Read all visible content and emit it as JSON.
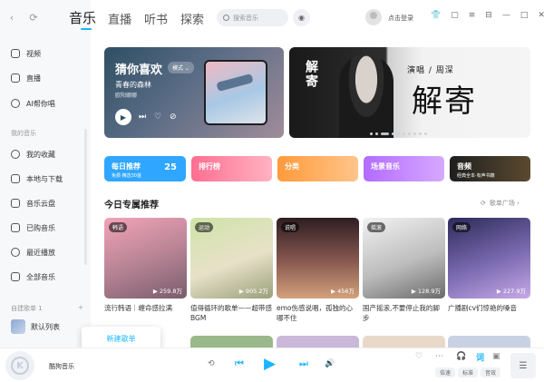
{
  "nav": {
    "back": "‹",
    "refresh": "⟳"
  },
  "sidebar": {
    "items_top": [
      {
        "label": "视频"
      },
      {
        "label": "直播"
      },
      {
        "label": "AI帮你唱"
      }
    ],
    "section_my": "我的音乐",
    "items_my": [
      {
        "label": "我的收藏"
      },
      {
        "label": "本地与下载"
      },
      {
        "label": "音乐云盘"
      },
      {
        "label": "已购音乐"
      },
      {
        "label": "最近播放"
      },
      {
        "label": "全部音乐"
      }
    ],
    "created_playlists": "自建歌单 1",
    "add": "+",
    "playlist": "默认列表"
  },
  "tabs": [
    {
      "label": "音乐"
    },
    {
      "label": "直播"
    },
    {
      "label": "听书"
    },
    {
      "label": "探索"
    }
  ],
  "search": {
    "placeholder": "搜索音乐"
  },
  "user": {
    "login": "点击登录"
  },
  "banner_left": {
    "title": "猜你喜欢",
    "mode": "模式 ⌄",
    "song": "青春的森林",
    "artist": "欧阳娜娜"
  },
  "banner_right": {
    "vertical": "解寄",
    "subtitle": "演唱 / 周深",
    "big": "解寄"
  },
  "categories": [
    {
      "label": "每日推荐",
      "sub": "免费·精选30首",
      "num": "25",
      "color": "#2fa6ff"
    },
    {
      "label": "排行榜",
      "color": "#ff6e91"
    },
    {
      "label": "分类",
      "color": "#ff9a3c"
    },
    {
      "label": "场景音乐",
      "color": "#b36bff"
    },
    {
      "label": "音频",
      "sub": "经典全本·有声书籍",
      "color": "#1e1e1e"
    }
  ],
  "section": {
    "title": "今日专属推荐",
    "more": "歌单广场 ›"
  },
  "cards": [
    {
      "tag": "韩语",
      "plays": "▶ 259.8万",
      "name": "流行韩语｜缠命感拉满",
      "c1": "#f3a3b8",
      "c2": "#7a5d6c"
    },
    {
      "tag": "运动",
      "plays": "▶ 905.2万",
      "name": "值得循环的歌单——超带感BGM",
      "c1": "#cfe3a8",
      "c2": "#e7e1c8"
    },
    {
      "tag": "说唱",
      "plays": "▶ 456万",
      "name": "emo伤感说唱，孤独的心哪不住",
      "c1": "#2e1d22",
      "c2": "#d4a17b"
    },
    {
      "tag": "摇滚",
      "plays": "▶ 128.9万",
      "name": "国产摇滚,不要停止我的脚步",
      "c1": "#f2f2f2",
      "c2": "#6a6a6a"
    },
    {
      "tag": "网络",
      "plays": "▶ 227.9万",
      "name": "广播剧cv们惊艳的嗓音",
      "c1": "#2d2a5a",
      "c2": "#c7a9e8"
    }
  ],
  "popup": {
    "label": "新建歌单"
  },
  "player": {
    "title": "酷狗音乐",
    "lyric": "词",
    "chips": [
      {
        "label": "倍速"
      },
      {
        "label": "标准"
      },
      {
        "label": "音效"
      }
    ],
    "queue": "☰"
  }
}
